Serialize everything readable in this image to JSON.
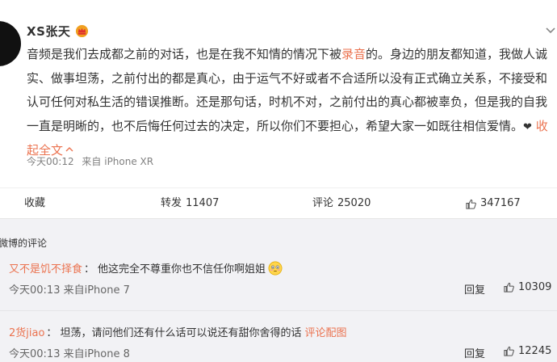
{
  "post": {
    "author": "XS张天",
    "text_before_link": "音频是我们去成都之前的对话，也是在我不知情的情况下被",
    "link_text": "录音",
    "text_after_link": "的。身边的朋友都知道，我做人诚实、做事坦荡，之前付出的都是真心，由于运气不好或者不合适所以没有正式确立关系，不接受和认可任何对私生活的错误推断。还是那句话，时机不对，之前付出的真心都被辜负，但是我的自我一直是明晰的，也不后悔任何过去的决定，所以你们不要担心，希望大家一如既往相信爱情。",
    "heart": "❤",
    "collapse_label": "收起全文",
    "time": "今天00:12",
    "source": "来自 iPhone XR"
  },
  "actions": {
    "favorite_label": "收藏",
    "forward_label": "转发",
    "forward_count": "11407",
    "comment_label": "评论",
    "comment_count": "25020",
    "like_count": "347167"
  },
  "comments": {
    "section_title": "微博的评论",
    "items": [
      {
        "user": "又不是饥不择食",
        "text": "他这完全不尊重你也不信任你啊姐姐",
        "emoji": "flushed-face",
        "time": "今天00:13",
        "source": "来自iPhone 7",
        "reply_label": "回复",
        "likes": "10309"
      },
      {
        "user": "2货jiao",
        "text": "坦荡，请问他们还有什么话可以说还有甜你舍得的话",
        "link_text": "评论配图",
        "time": "今天00:13",
        "source": "来自iPhone 8",
        "reply_label": "回复",
        "likes": "12245"
      }
    ]
  },
  "colors": {
    "accent": "#eb7350",
    "panel_bg": "#f2f2f5",
    "text": "#333333",
    "muted": "#808080"
  },
  "icons": {
    "verified": "crown-icon",
    "more": "chevron-down-icon",
    "like": "thumbs-up-icon",
    "collapse": "chevron-up-icon"
  }
}
